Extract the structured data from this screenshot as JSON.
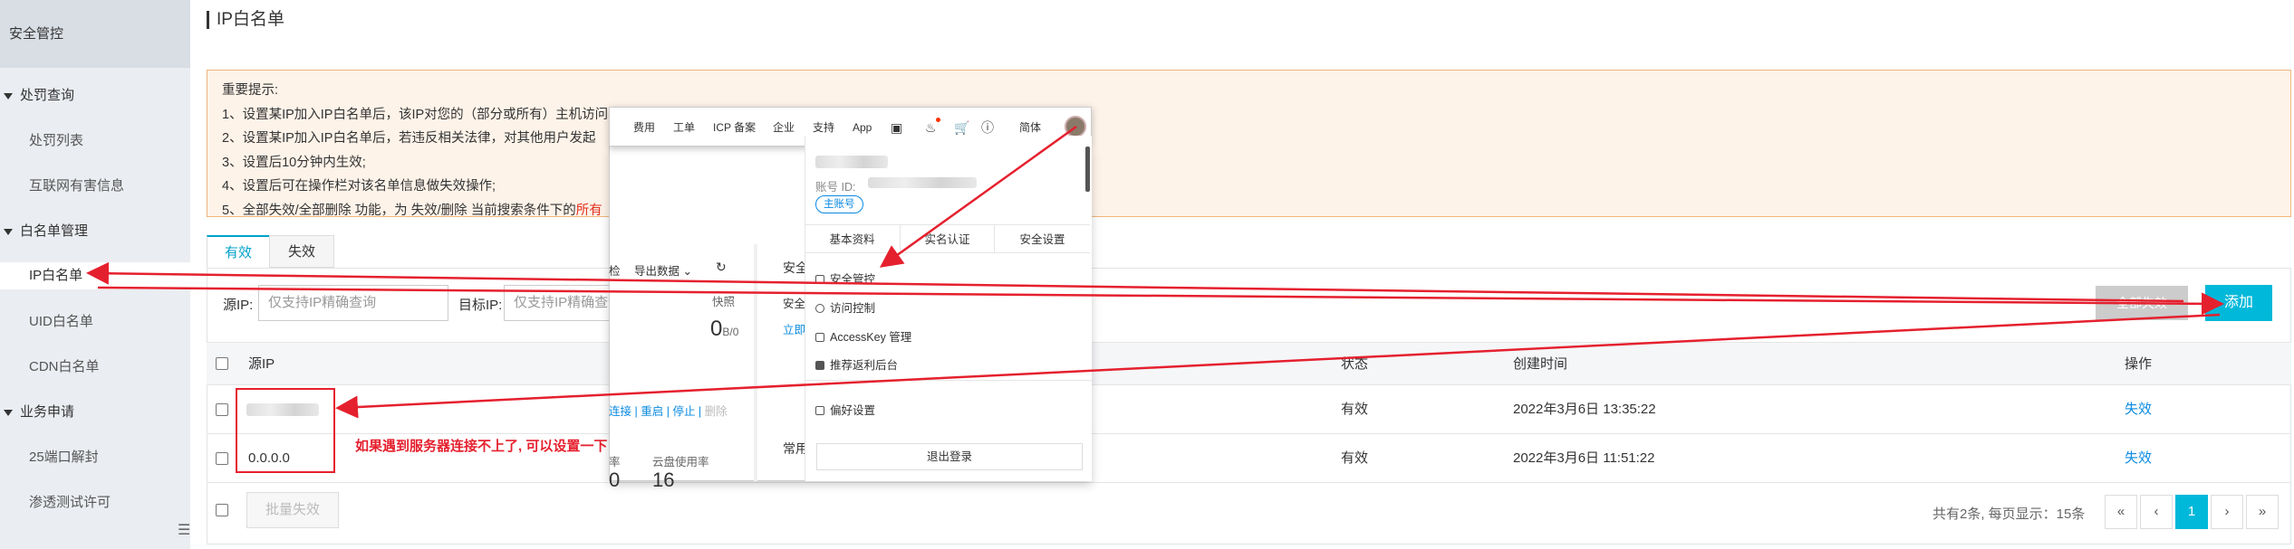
{
  "sidebar": {
    "title": "安全管控",
    "groups": [
      {
        "label": "处罚查询",
        "items": [
          "处罚列表",
          "互联网有害信息"
        ]
      },
      {
        "label": "白名单管理",
        "items": [
          "IP白名单",
          "UID白名单",
          "CDN白名单"
        ]
      },
      {
        "label": "业务申请",
        "items": [
          "25端口解封",
          "渗透测试许可"
        ]
      }
    ],
    "toggle_icon": "menu-icon"
  },
  "page": {
    "title": "IP白名单"
  },
  "notice": {
    "title": "重要提示:",
    "lines": [
      "1、设置某IP加入IP白名单后，该IP对您的（部分或所有）主机访问将不受亲眼安全检查限制，请谨慎操作。",
      "2、设置某IP加入IP白名单后，若违反相关法律，对其他用户发起",
      "3、设置后10分钟内生效;",
      "4、设置后可在操作栏对该名单信息做失效操作;",
      "5、全部失效/全部删除 功能，为 失效/删除 当前搜索条件下的"
    ],
    "line5_highlight": "所有"
  },
  "tabs": [
    "有效",
    "失效"
  ],
  "filters": {
    "src_label": "源IP:",
    "src_placeholder": "仅支持IP精确查询",
    "dst_label": "目标IP:",
    "dst_placeholder": "仅支持IP精确查询",
    "disable_all": "全部失效",
    "add": "添加"
  },
  "table": {
    "columns": [
      "源IP",
      "状态",
      "创建时间",
      "操作"
    ],
    "rows": [
      {
        "ip": "",
        "status": "有效",
        "created": "2022年3月6日 13:35:22",
        "action": "失效"
      },
      {
        "ip": "0.0.0.0",
        "status": "有效",
        "created": "2022年3月6日 11:51:22",
        "action": "失效"
      }
    ]
  },
  "annotation": "如果遇到服务器连接不上了, 可以设置一下白名单",
  "footer": {
    "batch": "批量失效",
    "summary": "共有2条, 每页显示：15条",
    "pages": [
      "«",
      "‹",
      "1",
      "›",
      "»"
    ],
    "current_page": "1"
  },
  "behind_panel": {
    "toolbar": [
      "检",
      "导出数据",
      "快照"
    ],
    "refresh_icon": "refresh-icon",
    "snapshot_value": "0",
    "snapshot_unit": "B/0",
    "actions": [
      "连接",
      "重启",
      "停止",
      "删除"
    ],
    "labels": [
      "率",
      "云盘使用率"
    ],
    "values": [
      "0",
      "16"
    ],
    "security_label": "安全",
    "security_sub": "安全",
    "security_link": "立即",
    "common_label": "常用"
  },
  "topbar": {
    "items": [
      "费用",
      "工单",
      "ICP 备案",
      "企业",
      "支持",
      "App"
    ],
    "lang": "简体",
    "icons": [
      "image-icon",
      "bell-icon",
      "cart-icon",
      "help-icon",
      "avatar"
    ]
  },
  "account": {
    "name": "",
    "id_label": "账号 ID:",
    "badge": "主账号",
    "tabs": [
      "基本资料",
      "实名认证",
      "安全设置"
    ],
    "menu": [
      "安全管控",
      "访问控制",
      "AccessKey 管理",
      "推荐返利后台",
      "偏好设置"
    ],
    "logout": "退出登录"
  },
  "colors": {
    "accent": "#00b8d9",
    "annotation": "#e5202e",
    "link": "#0a8ae0"
  }
}
